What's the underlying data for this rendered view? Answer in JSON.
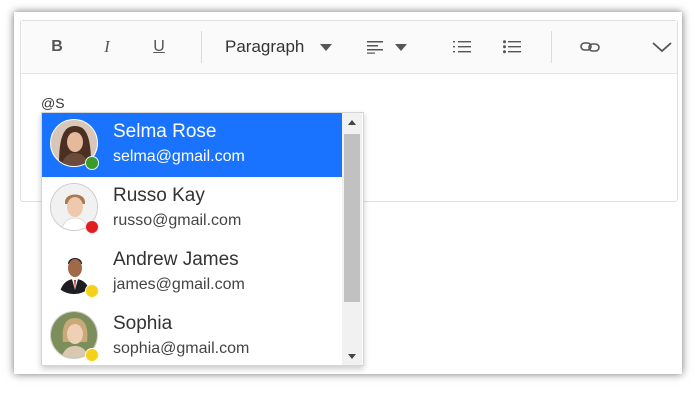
{
  "toolbar": {
    "bold": "B",
    "italic": "I",
    "underline": "U",
    "format_label": "Paragraph",
    "icons": [
      "align-left-icon",
      "ordered-list-icon",
      "unordered-list-icon",
      "link-icon",
      "chevron-down-icon"
    ]
  },
  "editor": {
    "content": "@S"
  },
  "mentions": {
    "selected_index": 0,
    "accent_color": "#1a73ff",
    "items": [
      {
        "name": "Selma Rose",
        "email": "selma@gmail.com",
        "status": "online",
        "status_color": "#3a9a2a"
      },
      {
        "name": "Russo Kay",
        "email": "russo@gmail.com",
        "status": "busy",
        "status_color": "#e02020"
      },
      {
        "name": "Andrew James",
        "email": "james@gmail.com",
        "status": "away",
        "status_color": "#f5d11a"
      },
      {
        "name": "Sophia",
        "email": "sophia@gmail.com",
        "status": "away",
        "status_color": "#f5d11a"
      }
    ]
  }
}
